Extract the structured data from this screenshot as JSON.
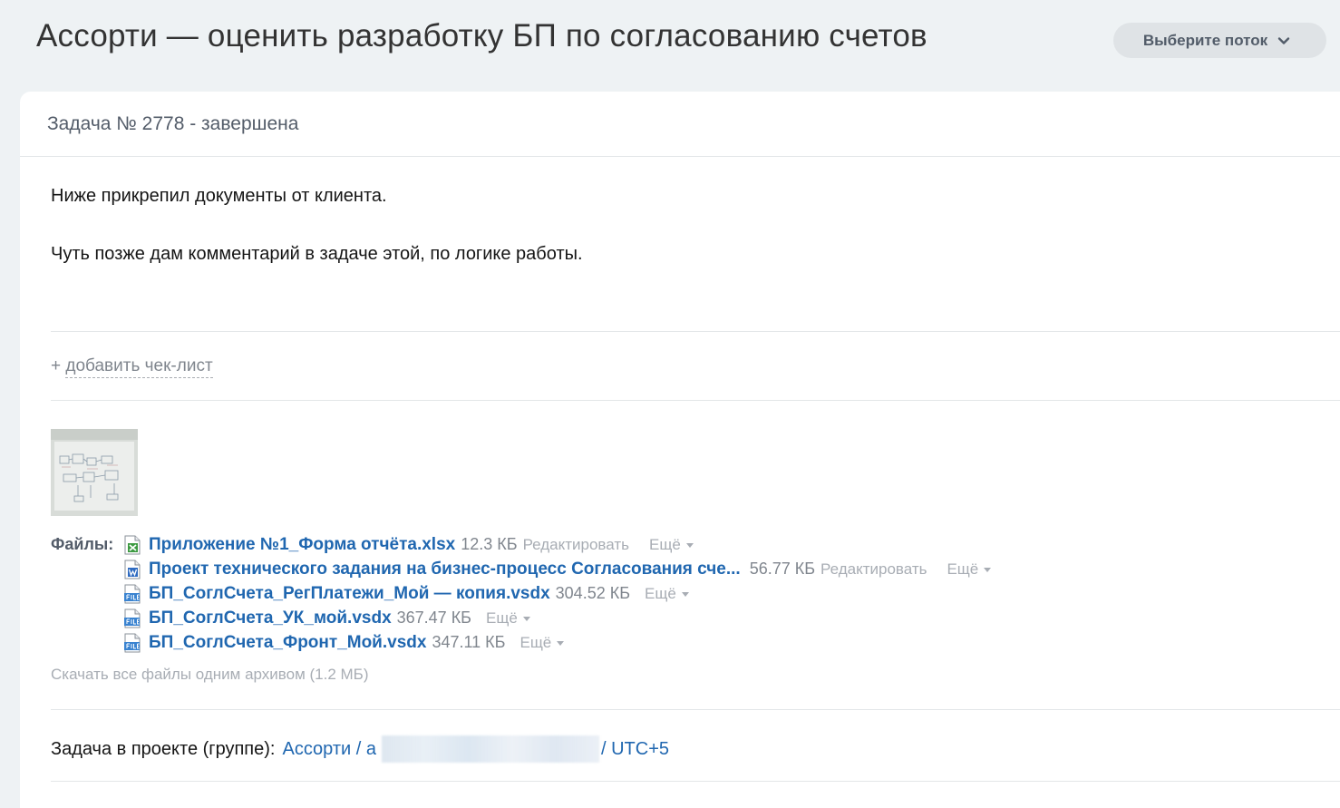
{
  "page": {
    "title": "Ассорти — оценить разработку БП по согласованию счетов",
    "flow_select_label": "Выберите поток"
  },
  "task": {
    "status_line": "Задача № 2778 - завершена",
    "description": [
      "Ниже прикрепил документы от клиента.",
      "Чуть позже дам комментарий в задаче этой, по логике работы."
    ],
    "add_checklist_plus": "+",
    "add_checklist_label": "добавить чек-лист"
  },
  "files": {
    "label": "Файлы:",
    "items": [
      {
        "icon": "excel-file-icon",
        "name": "Приложение №1_Форма отчёта.xlsx",
        "size": "12.3 КБ",
        "edit": "Редактировать",
        "more": "Ещё"
      },
      {
        "icon": "word-file-icon",
        "name": "Проект технического задания на бизнес-процесс Согласования сче...",
        "size": "56.77 КБ",
        "edit": "Редактировать",
        "more": "Ещё"
      },
      {
        "icon": "generic-file-icon",
        "name": "БП_СоглСчета_РегПлатежи_Мой — копия.vsdx",
        "size": "304.52 КБ",
        "edit": "",
        "more": "Ещё"
      },
      {
        "icon": "generic-file-icon",
        "name": "БП_СоглСчета_УК_мой.vsdx",
        "size": "367.47 КБ",
        "edit": "",
        "more": "Ещё"
      },
      {
        "icon": "generic-file-icon",
        "name": "БП_СоглСчета_Фронт_Мой.vsdx",
        "size": "347.11 КБ",
        "edit": "",
        "more": "Ещё"
      }
    ],
    "download_all": "Скачать все файлы одним архивом (1.2 МБ)"
  },
  "project": {
    "label": "Задача в проекте (группе):",
    "link_prefix": "Ассорти / а",
    "link_suffix": "/ UTC+5"
  },
  "colors": {
    "background": "#eef2f4",
    "link": "#2067b0",
    "muted": "#a8adb4"
  }
}
